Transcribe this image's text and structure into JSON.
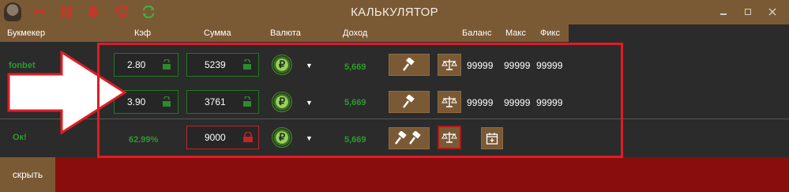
{
  "window": {
    "title": "КАЛЬКУЛЯТОР",
    "toolbar_icons": [
      "minus-icon",
      "pause-icon",
      "bell-icon",
      "tag-off-icon",
      "refresh-icon"
    ],
    "controls": [
      "minimize-icon",
      "maximize-icon",
      "close-icon"
    ]
  },
  "columns": {
    "bookmaker": "Букмекер",
    "coef": "Кэф",
    "sum": "Сумма",
    "currency": "Валюта",
    "income": "Доход",
    "balance": "Баланс",
    "max": "Макс",
    "fix": "Фикс"
  },
  "rows": [
    {
      "bookmaker": "fonbet",
      "coef": "2.80",
      "sum": "5239",
      "currency": "₽",
      "income": "5,669",
      "balance": "99999",
      "max": "99999",
      "fix": "99999"
    },
    {
      "bookmaker": "",
      "coef": "3.90",
      "sum": "3761",
      "currency": "₽",
      "income": "5,669",
      "balance": "99999",
      "max": "99999",
      "fix": "99999"
    }
  ],
  "summary": {
    "status": "Ок!",
    "percent": "62.99%",
    "total_sum": "9000",
    "currency": "₽",
    "income": "5,669"
  },
  "bottom": {
    "hide_label": "скрыть"
  },
  "colors": {
    "accent_brown": "#7a5a35",
    "positive_green": "#2e9a2e",
    "alert_red": "#e01c24",
    "bottom_red": "#8a0d0d"
  }
}
